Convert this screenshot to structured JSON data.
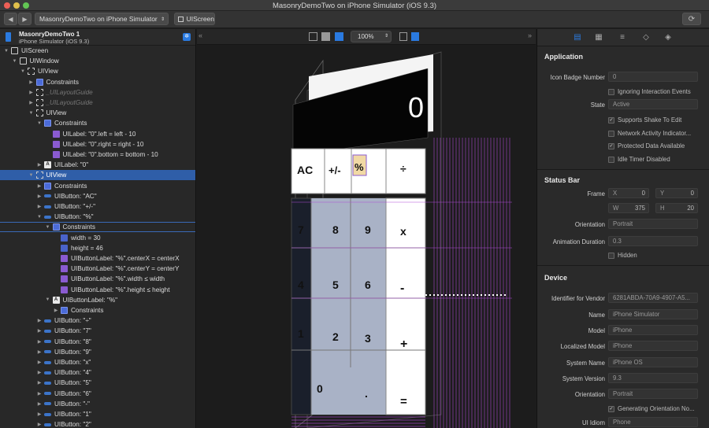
{
  "window": {
    "title": "MasonryDemoTwo on iPhone Simulator (iOS 9.3)"
  },
  "toolbar": {
    "scheme": "MasonryDemoTwo on iPhone Simulator",
    "breadcrumb": "UIScreen"
  },
  "left_header": {
    "app": "MasonryDemoTwo 1",
    "device": "iPhone Simulator (iOS 9.3)"
  },
  "tree": [
    {
      "label": "UIScreen",
      "depth": 0,
      "icon": "screen",
      "open": true
    },
    {
      "label": "UIWindow",
      "depth": 1,
      "icon": "screen",
      "open": true
    },
    {
      "label": "UIView",
      "depth": 2,
      "icon": "view",
      "open": true
    },
    {
      "label": "Constraints",
      "depth": 3,
      "icon": "cons",
      "open": false
    },
    {
      "label": "_UILayoutGuide",
      "depth": 3,
      "icon": "view",
      "open": false,
      "dim": true
    },
    {
      "label": "_UILayoutGuide",
      "depth": 3,
      "icon": "view",
      "open": false,
      "dim": true
    },
    {
      "label": "UIView",
      "depth": 3,
      "icon": "view",
      "open": true
    },
    {
      "label": "Constraints",
      "depth": 4,
      "icon": "cons",
      "open": true
    },
    {
      "label": "UILabel: \"0\".left = left - 10",
      "depth": 5,
      "icon": "c1",
      "leaf": true
    },
    {
      "label": "UILabel: \"0\".right = right - 10",
      "depth": 5,
      "icon": "c1",
      "leaf": true
    },
    {
      "label": "UILabel: \"0\".bottom = bottom - 10",
      "depth": 5,
      "icon": "c1",
      "leaf": true
    },
    {
      "label": "UILabel: \"0\"",
      "depth": 4,
      "icon": "lbl",
      "open": false
    },
    {
      "label": "UIView",
      "depth": 3,
      "icon": "view",
      "open": true,
      "selected": true
    },
    {
      "label": "Constraints",
      "depth": 4,
      "icon": "cons",
      "open": false
    },
    {
      "label": "UIButton: \"AC\"",
      "depth": 4,
      "icon": "btn",
      "open": false
    },
    {
      "label": "UIButton: \"+/-\"",
      "depth": 4,
      "icon": "btn",
      "open": false
    },
    {
      "label": "UIButton: \"%\"",
      "depth": 4,
      "icon": "btn",
      "open": true
    },
    {
      "label": "Constraints",
      "depth": 5,
      "icon": "cons",
      "open": true,
      "outlined": true
    },
    {
      "label": "width = 30",
      "depth": 6,
      "icon": "c2",
      "leaf": true
    },
    {
      "label": "height = 46",
      "depth": 6,
      "icon": "c2",
      "leaf": true
    },
    {
      "label": "UIButtonLabel: \"%\".centerX = centerX",
      "depth": 6,
      "icon": "c1",
      "leaf": true
    },
    {
      "label": "UIButtonLabel: \"%\".centerY = centerY",
      "depth": 6,
      "icon": "c1",
      "leaf": true
    },
    {
      "label": "UIButtonLabel: \"%\".width ≤ width",
      "depth": 6,
      "icon": "c1",
      "leaf": true
    },
    {
      "label": "UIButtonLabel: \"%\".height ≤ height",
      "depth": 6,
      "icon": "c1",
      "leaf": true
    },
    {
      "label": "UIButtonLabel: \"%\"",
      "depth": 5,
      "icon": "lbl",
      "open": true
    },
    {
      "label": "Constraints",
      "depth": 6,
      "icon": "cons",
      "open": false
    },
    {
      "label": "UIButton: \"÷\"",
      "depth": 4,
      "icon": "btn",
      "open": false
    },
    {
      "label": "UIButton: \"7\"",
      "depth": 4,
      "icon": "btn",
      "open": false
    },
    {
      "label": "UIButton: \"8\"",
      "depth": 4,
      "icon": "btn",
      "open": false
    },
    {
      "label": "UIButton: \"9\"",
      "depth": 4,
      "icon": "btn",
      "open": false
    },
    {
      "label": "UIButton: \"x\"",
      "depth": 4,
      "icon": "btn",
      "open": false
    },
    {
      "label": "UIButton: \"4\"",
      "depth": 4,
      "icon": "btn",
      "open": false
    },
    {
      "label": "UIButton: \"5\"",
      "depth": 4,
      "icon": "btn",
      "open": false
    },
    {
      "label": "UIButton: \"6\"",
      "depth": 4,
      "icon": "btn",
      "open": false
    },
    {
      "label": "UIButton: \"-\"",
      "depth": 4,
      "icon": "btn",
      "open": false
    },
    {
      "label": "UIButton: \"1\"",
      "depth": 4,
      "icon": "btn",
      "open": false
    },
    {
      "label": "UIButton: \"2\"",
      "depth": 4,
      "icon": "btn",
      "open": false
    }
  ],
  "canvas": {
    "zoom": "100%",
    "display_value": "0",
    "keys_top": [
      "AC",
      "+/-",
      "%",
      "÷"
    ],
    "keys_col1": [
      "7",
      "4",
      "1"
    ],
    "keys_col2": [
      "8",
      "5",
      "2"
    ],
    "keys_col3": [
      "9",
      "6",
      "3"
    ],
    "keys_ops": [
      "x",
      "-",
      "+",
      "="
    ],
    "key_zero": "0",
    "key_dot": "."
  },
  "inspector": {
    "application": {
      "title": "Application",
      "icon_badge_label": "Icon Badge Number",
      "icon_badge_value": "0",
      "ignoring_label": "Ignoring Interaction Events",
      "state_label": "State",
      "state_value": "Active",
      "supports_shake": "Supports Shake To Edit",
      "network_activity": "Network Activity Indicator...",
      "protected_data": "Protected Data Available",
      "idle_timer": "Idle Timer Disabled"
    },
    "status_bar": {
      "title": "Status Bar",
      "frame_label": "Frame",
      "x_label": "X",
      "x_value": "0",
      "y_label": "Y",
      "y_value": "0",
      "w_label": "W",
      "w_value": "375",
      "h_label": "H",
      "h_value": "20",
      "orientation_label": "Orientation",
      "orientation_value": "Portrait",
      "anim_label": "Animation Duration",
      "anim_value": "0.3",
      "hidden_label": "Hidden"
    },
    "device": {
      "title": "Device",
      "vendor_label": "Identifier for Vendor",
      "vendor_value": "6281ABDA-70A9-4907-A5...",
      "name_label": "Name",
      "name_value": "iPhone Simulator",
      "model_label": "Model",
      "model_value": "iPhone",
      "lmodel_label": "Localized Model",
      "lmodel_value": "iPhone",
      "sysname_label": "System Name",
      "sysname_value": "iPhone OS",
      "sysver_label": "System Version",
      "sysver_value": "9.3",
      "orient_label": "Orientation",
      "orient_value": "Portrait",
      "gen_orient": "Generating Orientation No...",
      "idiom_label": "UI Idiom",
      "idiom_value": "Phone"
    }
  }
}
